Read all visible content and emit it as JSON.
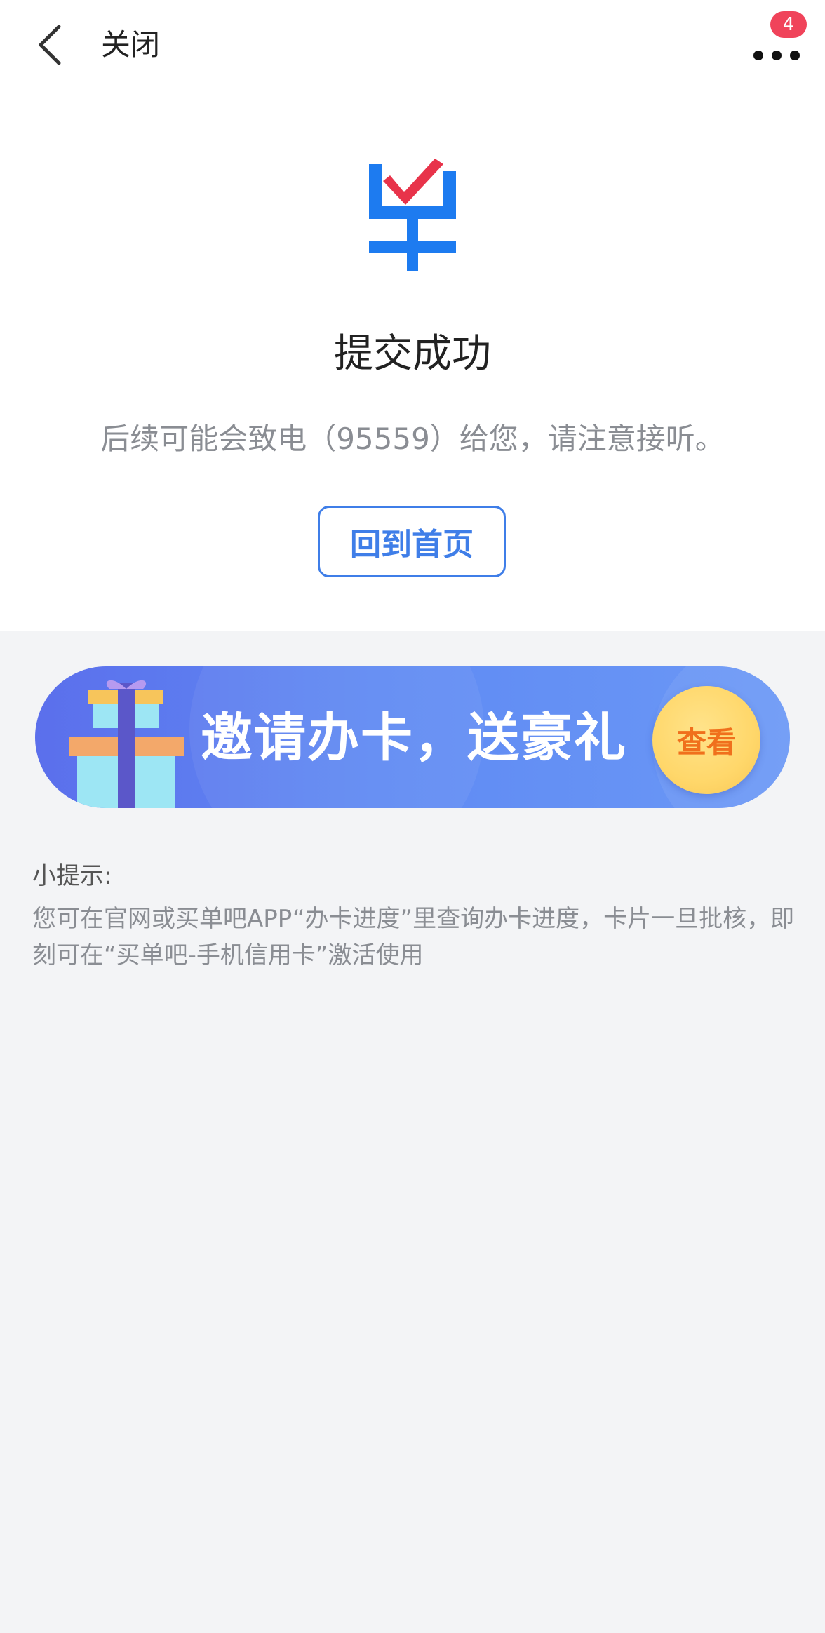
{
  "navbar": {
    "close_label": "关闭",
    "notification_count": "4"
  },
  "logo": {
    "icon": "checkmark-card-logo",
    "colors": {
      "primary": "#1d7bf0",
      "check": "#e8334a"
    }
  },
  "result": {
    "title": "提交成功",
    "subtitle": "后续可能会致电（95559）给您，请注意接听。",
    "home_button_label": "回到首页"
  },
  "banner": {
    "text": "邀请办卡，送豪礼",
    "view_button_label": "查看"
  },
  "tips": {
    "title": "小提示:",
    "body": "您可在官网或买单吧APP“办卡进度”里查询办卡进度，卡片一旦批核，即刻可在“买单吧-手机信用卡”激活使用"
  },
  "colors": {
    "accent": "#3f7ee8",
    "badge": "#f0435a",
    "page_background": "#f3f4f6"
  }
}
